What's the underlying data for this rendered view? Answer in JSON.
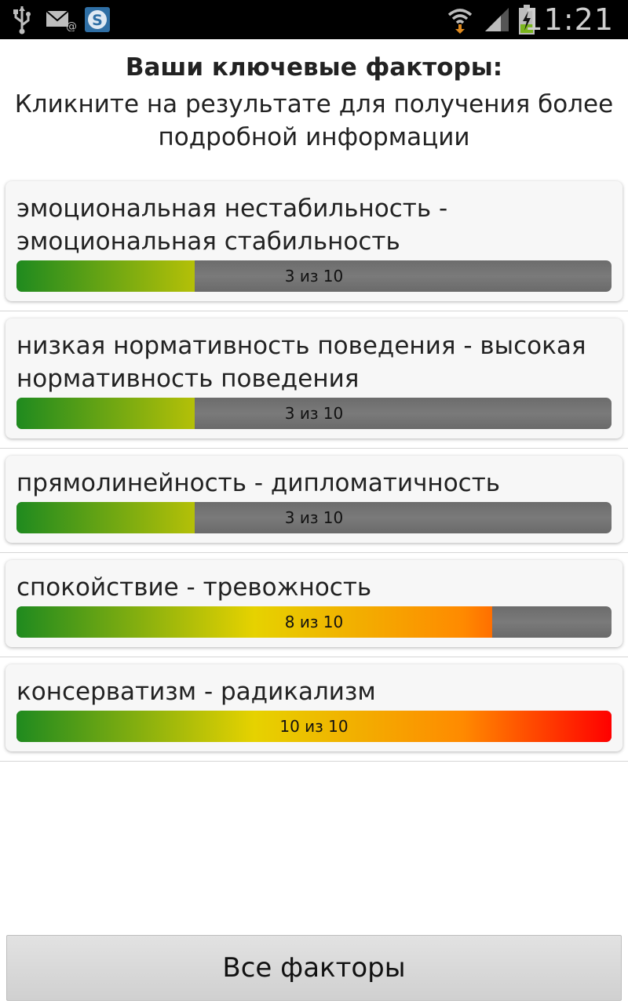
{
  "status_bar": {
    "time": "11:21",
    "left_icons": [
      "usb-icon",
      "mail-icon",
      "skype-icon"
    ],
    "right_icons": [
      "wifi-icon",
      "signal-icon",
      "battery-charging-icon"
    ]
  },
  "header": {
    "title": "Ваши ключевые факторы:",
    "subtitle": "Кликните на результате для получения более подробной информации"
  },
  "factors": [
    {
      "label": "эмоциональная нестабильность - эмоциональная стабильность",
      "score": 3,
      "max": 10,
      "score_text": "3 из 10"
    },
    {
      "label": "низкая нормативность поведения - высокая нормативность поведения",
      "score": 3,
      "max": 10,
      "score_text": "3 из 10"
    },
    {
      "label": "прямолинейность - дипломатичность",
      "score": 3,
      "max": 10,
      "score_text": "3 из 10"
    },
    {
      "label": "спокойствие - тревожность",
      "score": 8,
      "max": 10,
      "score_text": "8 из 10"
    },
    {
      "label": "консерватизм - радикализм",
      "score": 10,
      "max": 10,
      "score_text": "10 из 10"
    }
  ],
  "bar_colors": [
    "#1f8a1f",
    "#e6d200",
    "#ff8a00",
    "#ff0000"
  ],
  "bar_track_color": "#707070",
  "footer": {
    "all_factors_label": "Все факторы"
  }
}
